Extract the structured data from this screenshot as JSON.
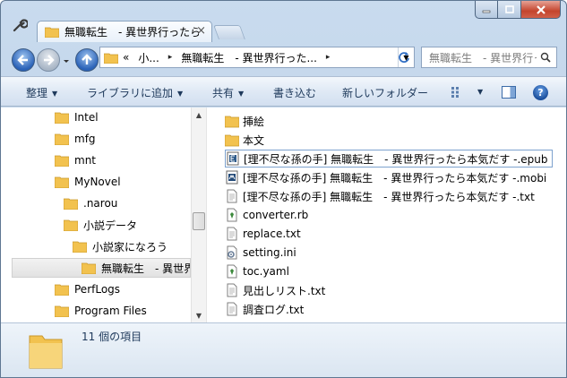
{
  "window": {
    "tab_title": "無職転生　- 異世界行ったら本気だす -",
    "tab_close": "×"
  },
  "address": {
    "overflow": "«",
    "crumbs": [
      "小...",
      "無職転生　- 異世界行った..."
    ],
    "crumb_arrow": "▸",
    "dropdown": "▼",
    "search_placeholder": "無職転生　- 異世界行ったら本気だす -の検索"
  },
  "commands": {
    "organize": "整理",
    "add_to_library": "ライブラリに追加",
    "share": "共有",
    "burn": "書き込む",
    "new_folder": "新しいフォルダー",
    "arrow": "▼"
  },
  "nav_tree": [
    {
      "label": "Intel",
      "icon": "folder-icon"
    },
    {
      "label": "mfg",
      "icon": "folder-icon"
    },
    {
      "label": "mnt",
      "icon": "folder-icon"
    },
    {
      "label": "MyNovel",
      "icon": "folder-icon"
    },
    {
      "label": ".narou",
      "icon": "folder-icon"
    },
    {
      "label": "小説データ",
      "icon": "folder-icon"
    },
    {
      "label": "小説家になろう",
      "icon": "folder-icon"
    },
    {
      "label": "無職転生　- 異世界行ったら本気だす -",
      "icon": "folder-icon",
      "selected": true
    },
    {
      "label": "PerfLogs",
      "icon": "folder-icon"
    },
    {
      "label": "Program Files",
      "icon": "folder-icon"
    }
  ],
  "files": [
    {
      "name": "挿絵",
      "icon": "folder-icon"
    },
    {
      "name": "本文",
      "icon": "folder-icon"
    },
    {
      "name": "[理不尽な孫の手] 無職転生　- 異世界行ったら本気だす -.epub",
      "icon": "epub-icon",
      "focused": true
    },
    {
      "name": "[理不尽な孫の手] 無職転生　- 異世界行ったら本気だす -.mobi",
      "icon": "mobi-icon"
    },
    {
      "name": "[理不尽な孫の手] 無職転生　- 異世界行ったら本気だす -.txt",
      "icon": "text-file-icon"
    },
    {
      "name": "converter.rb",
      "icon": "ruby-file-icon"
    },
    {
      "name": "replace.txt",
      "icon": "text-file-icon"
    },
    {
      "name": "setting.ini",
      "icon": "settings-file-icon"
    },
    {
      "name": "toc.yaml",
      "icon": "ruby-file-icon"
    },
    {
      "name": "見出しリスト.txt",
      "icon": "text-file-icon"
    },
    {
      "name": "調査ログ.txt",
      "icon": "text-file-icon"
    }
  ],
  "details": {
    "item_count": "11 個の項目"
  },
  "colors": {
    "frame": "#c9dbee",
    "command_text": "#1e395b",
    "folder": "#f2c24f"
  }
}
